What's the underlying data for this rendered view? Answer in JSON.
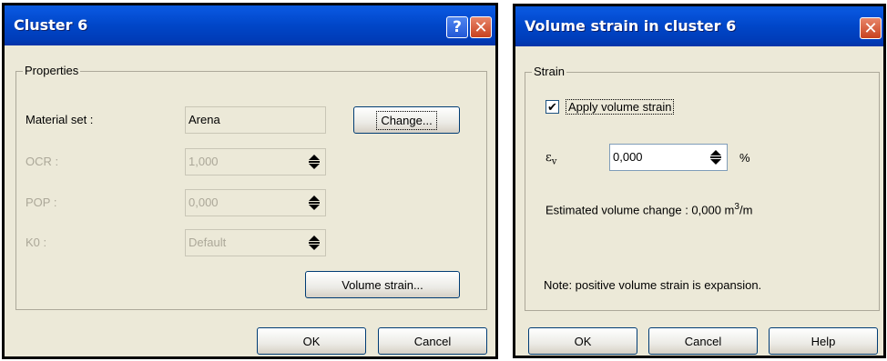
{
  "cluster": {
    "title": "Cluster 6",
    "help_glyph": "?",
    "close_glyph": "✕",
    "properties_label": "Properties",
    "material_set_label": "Material set :",
    "material_set_value": "Arena",
    "change_label": "Change...",
    "ocr_label": "OCR :",
    "ocr_value": "1,000",
    "pop_label": "POP :",
    "pop_value": "0,000",
    "k0_label": "K0 :",
    "k0_value": "Default",
    "volume_strain_label": "Volume strain...",
    "ok_label": "OK",
    "cancel_label": "Cancel"
  },
  "volume": {
    "title": "Volume strain in cluster 6",
    "close_glyph": "✕",
    "strain_label": "Strain",
    "apply_checked_glyph": "✔",
    "apply_label": "Apply volume strain",
    "epsilon_symbol": "ε",
    "epsilon_sub": "v",
    "epsilon_value": "0,000",
    "percent": "%",
    "estimated_prefix": "Estimated volume change : 0,000 m",
    "estimated_sup": "3",
    "estimated_suffix": "/m",
    "note": "Note: positive volume strain is expansion.",
    "ok_label": "OK",
    "cancel_label": "Cancel",
    "help_label": "Help"
  },
  "colors": {
    "titlebar": "#0046c8",
    "dialog_bg": "#ece9d8",
    "close_button": "#c8411e",
    "disabled_text": "#aca899"
  }
}
